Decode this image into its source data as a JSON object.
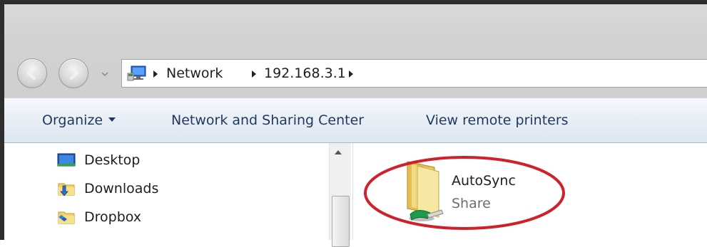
{
  "address_bar": {
    "crumbs": [
      "Network",
      "192.168.3.1"
    ],
    "icon": "network-computer-icon"
  },
  "toolbar": {
    "organize_label": "Organize",
    "network_sharing_label": "Network and Sharing Center",
    "remote_printers_label": "View remote printers"
  },
  "nav_pane": {
    "items": [
      {
        "label": "Desktop",
        "icon": "desktop-icon"
      },
      {
        "label": "Downloads",
        "icon": "downloads-folder-icon"
      },
      {
        "label": "Dropbox",
        "icon": "dropbox-folder-icon"
      }
    ]
  },
  "content": {
    "items": [
      {
        "name": "AutoSync",
        "type": "Share",
        "icon": "shared-folder-icon"
      }
    ]
  },
  "colors": {
    "annotation_ellipse": "#d0202a",
    "toolbar_text": "#1e395b"
  }
}
